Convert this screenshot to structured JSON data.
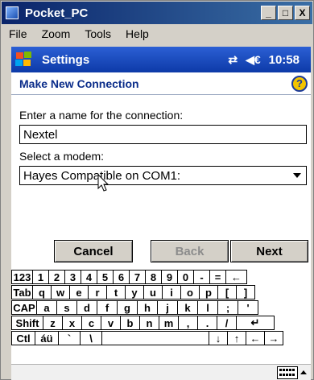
{
  "window": {
    "title": "Pocket_PC",
    "controls": {
      "minimize": "_",
      "restore": "□",
      "close": "X"
    }
  },
  "menu": [
    "File",
    "Zoom",
    "Tools",
    "Help"
  ],
  "navbar": {
    "title": "Settings",
    "time": "10:58",
    "icons": [
      "windows-start-icon",
      "connectivity-icon",
      "volume-icon"
    ]
  },
  "header": {
    "title": "Make New Connection",
    "help": "?"
  },
  "form": {
    "name_label": "Enter a name for the connection:",
    "name_value": "Nextel",
    "modem_label": "Select a modem:",
    "modem_value": "Hayes Compatible on COM1:"
  },
  "buttons": {
    "cancel": "Cancel",
    "back": "Back",
    "next": "Next"
  },
  "keyboard": {
    "row1": [
      "123",
      "1",
      "2",
      "3",
      "4",
      "5",
      "6",
      "7",
      "8",
      "9",
      "0",
      "-",
      "=",
      "←"
    ],
    "row2": [
      "Tab",
      "q",
      "w",
      "e",
      "r",
      "t",
      "y",
      "u",
      "i",
      "o",
      "p",
      "[",
      "]"
    ],
    "row3": [
      "CAP",
      "a",
      "s",
      "d",
      "f",
      "g",
      "h",
      "j",
      "k",
      "l",
      ";",
      "'"
    ],
    "row4": [
      "Shift",
      "z",
      "x",
      "c",
      "v",
      "b",
      "n",
      "m",
      ",",
      ".",
      "/",
      "↵"
    ],
    "row5": [
      "Ctl",
      "áü",
      "`",
      "\\",
      "",
      "↓",
      "↑",
      "←",
      "→"
    ]
  },
  "colors": {
    "nav_blue": "#1848c0",
    "header_text": "#0b2d8a",
    "chrome": "#d4d0c8"
  }
}
